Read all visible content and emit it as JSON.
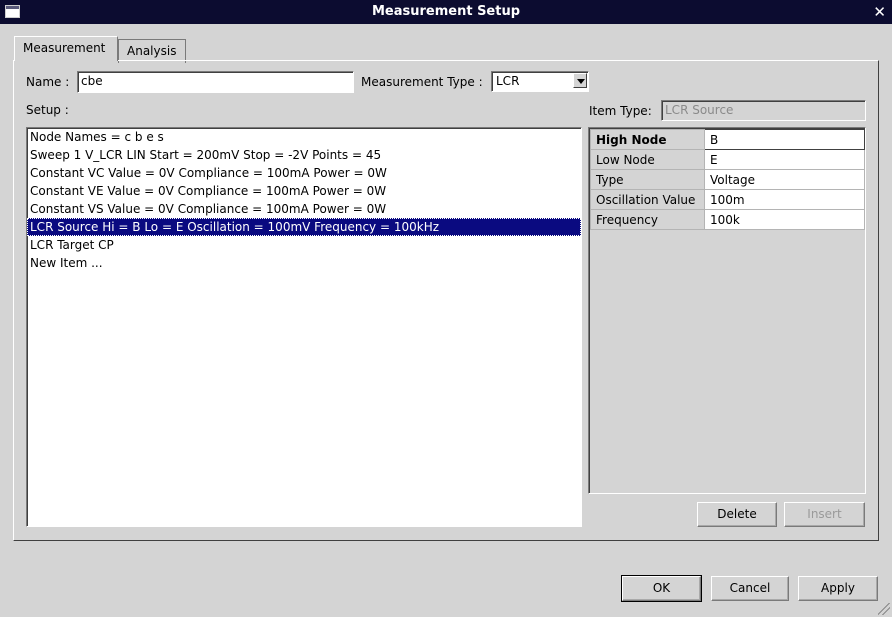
{
  "window": {
    "title": "Measurement Setup"
  },
  "tabs": [
    {
      "label": "Measurement",
      "active": true
    },
    {
      "label": "Analysis",
      "active": false
    }
  ],
  "name_field": {
    "label": "Name :",
    "value": "cbe"
  },
  "measurement_type": {
    "label": "Measurement Type :",
    "value": "LCR"
  },
  "setup": {
    "label": "Setup :",
    "items": [
      "Node Names = c b e s",
      "Sweep 1 V_LCR LIN Start = 200mV Stop = -2V Points = 45",
      "Constant VC Value = 0V Compliance = 100mA Power = 0W",
      "Constant VE Value = 0V Compliance = 100mA Power = 0W",
      "Constant VS Value = 0V Compliance = 100mA Power = 0W",
      "LCR Source Hi = B Lo = E Oscillation = 100mV Frequency = 100kHz",
      "LCR Target CP",
      "New Item ..."
    ],
    "selected_index": 5
  },
  "item_type": {
    "label": "Item Type:",
    "value": "LCR Source"
  },
  "properties": [
    {
      "key": "High Node",
      "value": "B"
    },
    {
      "key": "Low Node",
      "value": "E"
    },
    {
      "key": "Type",
      "value": "Voltage"
    },
    {
      "key": "Oscillation Value",
      "value": "100m"
    },
    {
      "key": "Frequency",
      "value": "100k"
    }
  ],
  "buttons": {
    "delete": "Delete",
    "insert": "Insert",
    "ok": "OK",
    "cancel": "Cancel",
    "apply": "Apply"
  },
  "colors": {
    "title_bar": "#0c0c30",
    "selection": "#0a0a80",
    "window_bg": "#d4d4d4"
  },
  "icons": {
    "window": "window-icon",
    "close": "close-icon",
    "dropdown": "chevron-down-icon"
  }
}
